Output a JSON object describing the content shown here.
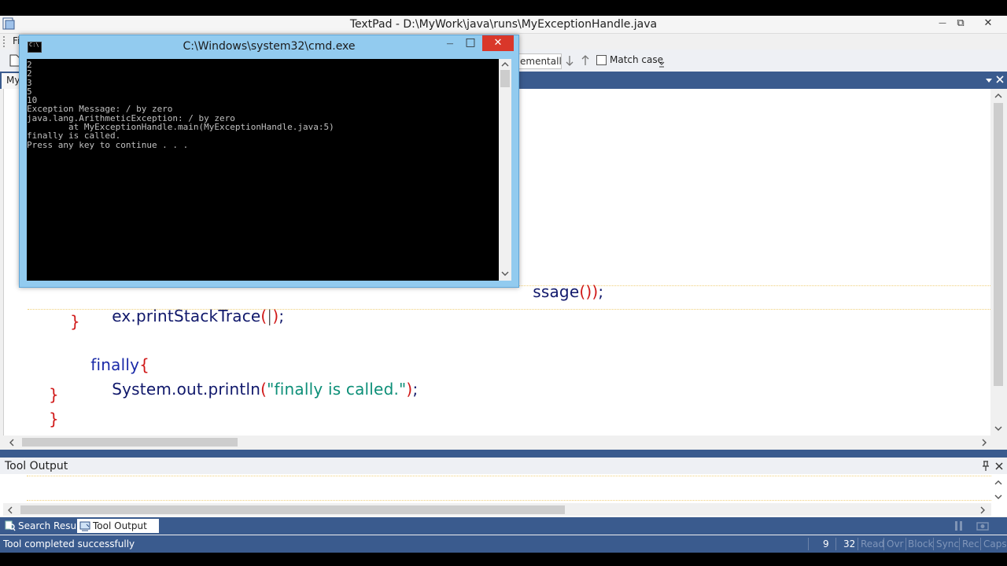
{
  "window": {
    "title": "TextPad - D:\\MyWork\\java\\runs\\MyExceptionHandle.java",
    "controls": {
      "minimize": "—",
      "restore": "⧉",
      "close": "✕"
    }
  },
  "menubar": {
    "first_item": "Fi"
  },
  "toolbar": {
    "search_mode_label": "ementally",
    "match_case_label": "Match case",
    "match_case_checked": false
  },
  "doc_tabs": [
    {
      "label": "My"
    }
  ],
  "editor": {
    "lines": [
      {
        "indent": 2,
        "parts": [
          {
            "t": "ssage",
            "c": "code"
          },
          {
            "t": "()",
            "c": "brace"
          },
          {
            "t": ")",
            "c": "brace"
          },
          {
            "t": ";",
            "c": "code"
          }
        ]
      },
      {
        "text": "ex.printStackTrace();"
      },
      {
        "text": "}"
      },
      {
        "text": "finally{"
      },
      {
        "text": "System.out.println(\"finally is called.\");"
      },
      {
        "text": "}"
      },
      {
        "text": "}"
      }
    ],
    "line1_tail": {
      "a": "ssage",
      "b": "())",
      "c": ";"
    },
    "line2": {
      "a": "ex.printStackTrace",
      "b": "(",
      "cursor": "|",
      "c": ")",
      "d": ";"
    },
    "line3": {
      "a": "}"
    },
    "line4": {
      "a": "finally",
      "b": "{"
    },
    "line5": {
      "a": "System.out.println",
      "b": "(",
      "c": "\"finally is called.\"",
      "d": ")",
      "e": ";"
    },
    "line6": {
      "a": "}"
    },
    "line7": {
      "a": "}"
    }
  },
  "cmd": {
    "title": "C:\\Windows\\system32\\cmd.exe",
    "output": "2\n2\n3\n5\n10\nException Message: / by zero\njava.lang.ArithmeticException: / by zero\n        at MyExceptionHandle.main(MyExceptionHandle.java:5)\nfinally is called.\nPress any key to continue . . .",
    "controls": {
      "minimize": "—",
      "maximize": "□",
      "close": "✕"
    },
    "icon_text": "C:\\"
  },
  "tool_output": {
    "title": "Tool Output"
  },
  "bottom_tabs": [
    {
      "label": "Search Results",
      "icon": "search-results-icon"
    },
    {
      "label": "Tool Output",
      "icon": "tool-output-icon",
      "active": true
    }
  ],
  "statusbar": {
    "message": "Tool completed successfully",
    "line": "9",
    "column": "32",
    "indicators": [
      "Read",
      "Ovr",
      "Block",
      "Sync",
      "Rec",
      "Caps"
    ]
  },
  "colors": {
    "code_text": "#10186b",
    "brace": "#d01818",
    "string": "#0d8f78",
    "status_bar": "#3a5b8e",
    "cmd_frame": "#92cbef"
  }
}
